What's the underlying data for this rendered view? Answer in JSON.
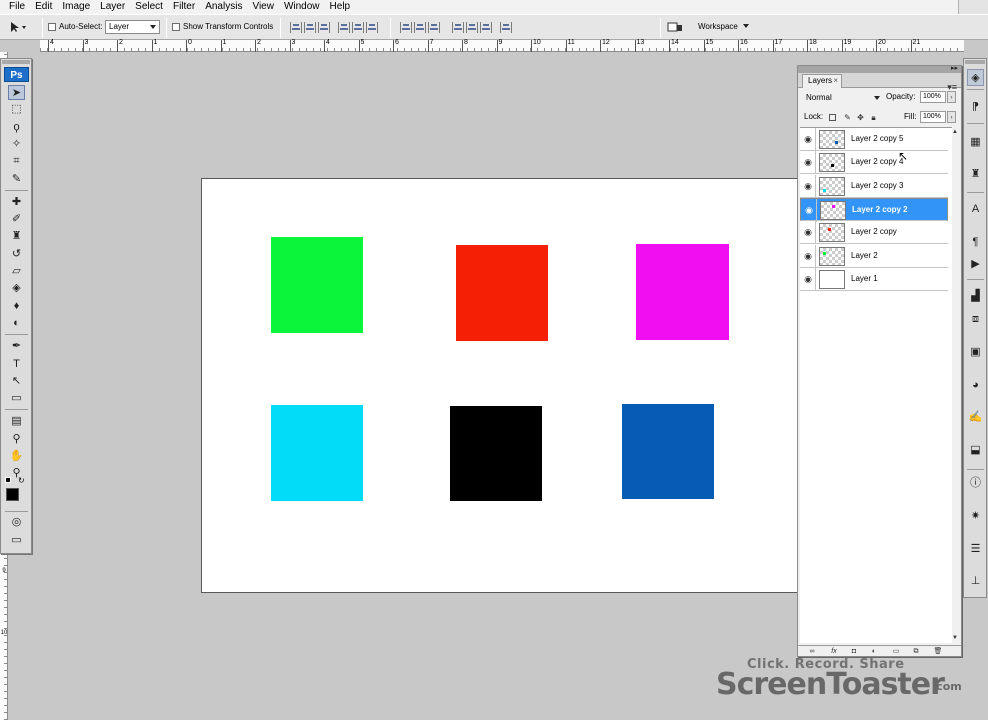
{
  "menu": [
    "File",
    "Edit",
    "Image",
    "Layer",
    "Select",
    "Filter",
    "Analysis",
    "View",
    "Window",
    "Help"
  ],
  "options_bar": {
    "auto_select_label": "Auto-Select:",
    "auto_select_value": "Layer",
    "show_transform_label": "Show Transform Controls",
    "workspace_label": "Workspace"
  },
  "ruler_top_numbers": [
    "4",
    "3",
    "2",
    "1",
    "0",
    "1",
    "2",
    "3",
    "4",
    "5",
    "6",
    "7",
    "8",
    "9",
    "10",
    "11",
    "12",
    "13",
    "14",
    "15",
    "16",
    "17",
    "18",
    "19",
    "20",
    "21"
  ],
  "ruler_left_numbers": [
    "1",
    "2",
    "3",
    "4",
    "5",
    "6",
    "7",
    "8",
    "9",
    "10"
  ],
  "tools_panel": {
    "logo": "Ps",
    "tools": [
      {
        "name": "move-tool-icon",
        "glyph": "➤",
        "active": true
      },
      {
        "name": "marquee-tool-icon",
        "glyph": "⬚"
      },
      {
        "name": "lasso-tool-icon",
        "glyph": "ϙ"
      },
      {
        "name": "magic-wand-tool-icon",
        "glyph": "✧"
      },
      {
        "name": "crop-tool-icon",
        "glyph": "⌗"
      },
      {
        "name": "eyedropper-tool-icon",
        "glyph": "✎"
      },
      {
        "name": "healing-brush-tool-icon",
        "glyph": "✚"
      },
      {
        "name": "brush-tool-icon",
        "glyph": "✐"
      },
      {
        "name": "clone-stamp-tool-icon",
        "glyph": "♜"
      },
      {
        "name": "history-brush-tool-icon",
        "glyph": "↺"
      },
      {
        "name": "eraser-tool-icon",
        "glyph": "▱"
      },
      {
        "name": "paint-bucket-tool-icon",
        "glyph": "◈"
      },
      {
        "name": "blur-tool-icon",
        "glyph": "♦"
      },
      {
        "name": "dodge-tool-icon",
        "glyph": "◐"
      },
      {
        "name": "pen-tool-icon",
        "glyph": "✒"
      },
      {
        "name": "type-tool-icon",
        "glyph": "T"
      },
      {
        "name": "path-selection-tool-icon",
        "glyph": "↖"
      },
      {
        "name": "shape-tool-icon",
        "glyph": "▭"
      },
      {
        "name": "notes-tool-icon",
        "glyph": "▤"
      },
      {
        "name": "eyedropper-2-tool-icon",
        "glyph": "⚲"
      },
      {
        "name": "hand-tool-icon",
        "glyph": "✋"
      },
      {
        "name": "zoom-tool-icon",
        "glyph": "⚲"
      }
    ],
    "fg_color": "#000000",
    "bg_color": "#ffffff"
  },
  "canvas": {
    "squares": [
      {
        "name": "green-square",
        "color": "#0bf53b"
      },
      {
        "name": "red-square",
        "color": "#f51f06"
      },
      {
        "name": "magenta-square",
        "color": "#f00ff1"
      },
      {
        "name": "cyan-square",
        "color": "#03dcf8"
      },
      {
        "name": "black-square",
        "color": "#000000"
      },
      {
        "name": "blue-square",
        "color": "#065cb3"
      }
    ]
  },
  "layers_panel": {
    "tab_label": "Layers",
    "blend_mode": "Normal",
    "opacity_label": "Opacity:",
    "opacity_value": "100%",
    "lock_label": "Lock:",
    "fill_label": "Fill:",
    "fill_value": "100%",
    "layers": [
      {
        "name": "Layer 2 copy 5",
        "selected": false,
        "dot_color": "#065cb3"
      },
      {
        "name": "Layer 2 copy 4",
        "selected": false,
        "dot_color": "#000000"
      },
      {
        "name": "Layer 2 copy 3",
        "selected": false,
        "dot_color": "#03dcf8"
      },
      {
        "name": "Layer 2 copy 2",
        "selected": true,
        "dot_color": "#f00ff1"
      },
      {
        "name": "Layer 2 copy",
        "selected": false,
        "dot_color": "#f51f06"
      },
      {
        "name": "Layer 2",
        "selected": false,
        "dot_color": "#0bf53b"
      },
      {
        "name": "Layer 1",
        "selected": false,
        "dot_color": "#ffffff"
      }
    ]
  },
  "watermark": {
    "line1": "Click. Record. Share",
    "line2": "ScreenToaster",
    "line3": ".com"
  },
  "colors": {
    "selection_blue": "#3294f7",
    "workspace_gray": "#c8c8c8"
  }
}
